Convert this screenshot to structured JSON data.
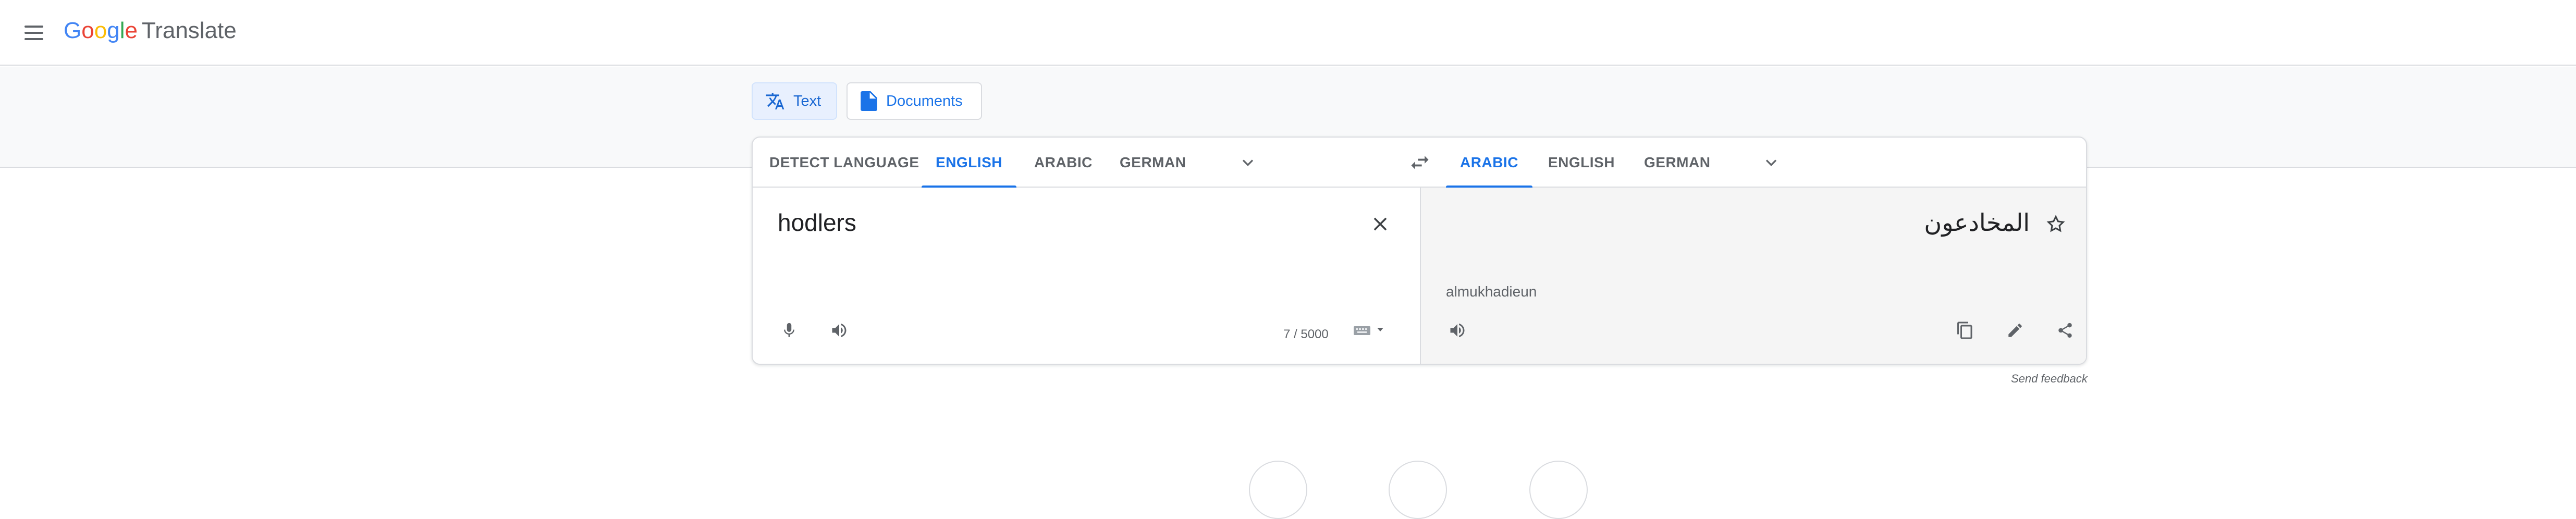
{
  "header": {
    "logo_letters": [
      "G",
      "o",
      "o",
      "g",
      "l",
      "e"
    ],
    "product_name": "Translate",
    "menu_icon": "hamburger-menu-icon"
  },
  "modes": [
    {
      "label": "Text",
      "icon": "translate-icon",
      "active": true
    },
    {
      "label": "Documents",
      "icon": "document-icon",
      "active": false
    }
  ],
  "source_languages": [
    "DETECT LANGUAGE",
    "ENGLISH",
    "ARABIC",
    "GERMAN"
  ],
  "source_active": "ENGLISH",
  "target_languages": [
    "ARABIC",
    "ENGLISH",
    "GERMAN"
  ],
  "target_active": "ARABIC",
  "source": {
    "text": "hodlers",
    "char_count": "7 / 5000"
  },
  "target": {
    "text": "المخادعون",
    "transliteration": "almukhadieun"
  },
  "footer": {
    "send_feedback": "Send feedback"
  },
  "colors": {
    "accent": "#1a73e8",
    "panel_gray": "#f5f5f5",
    "band_gray": "#f8f9fa",
    "icon_gray": "#5f6368"
  }
}
